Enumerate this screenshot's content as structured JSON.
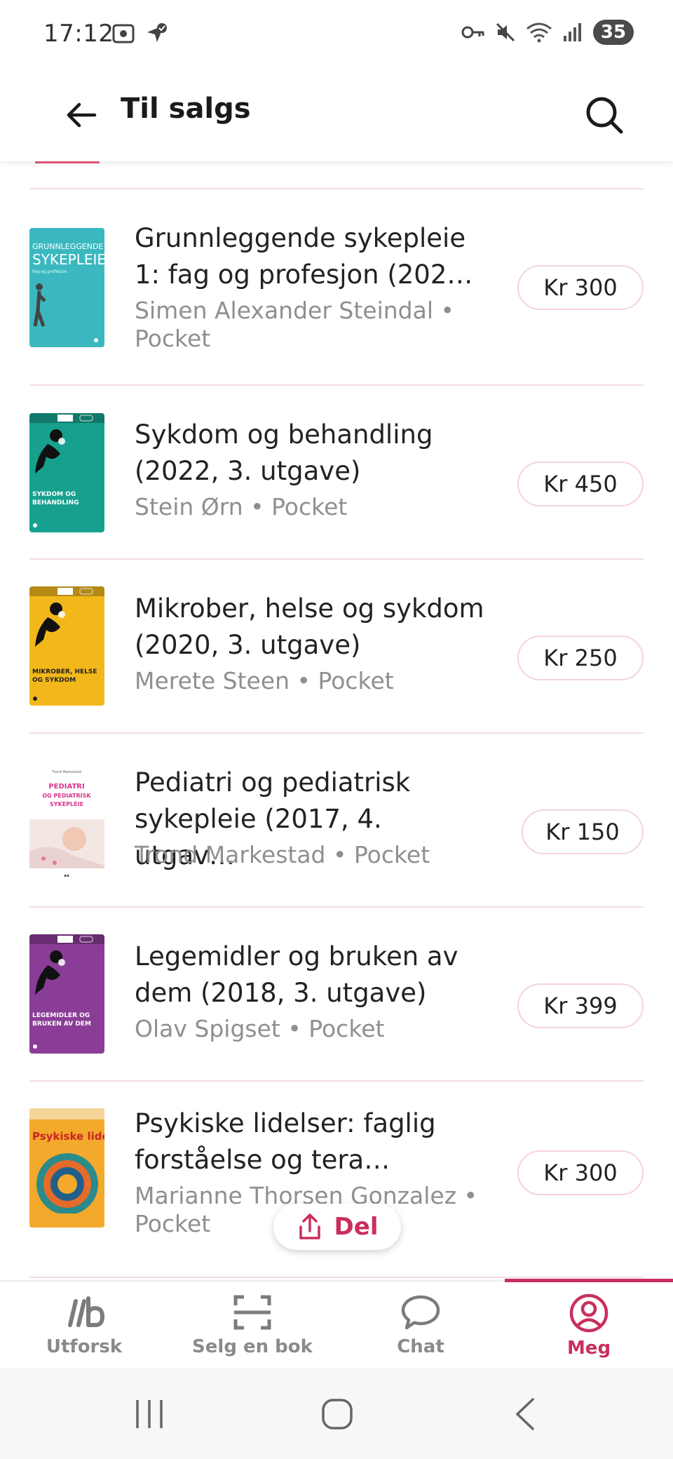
{
  "status_bar": {
    "time": "17:12",
    "battery": "35"
  },
  "app_bar": {
    "title": "Til salgs"
  },
  "books": [
    {
      "title": "Grunnleggende sykepleie 1: fag og profesjon (202…",
      "meta": "Simen Alexander Steindal • Pocket",
      "price": "Kr 300",
      "cover_color": "#3bb8bf",
      "cover_text": "GRUNNLEGGENDE SYKEPLEIE",
      "cover_sub": "Fag og profesjon"
    },
    {
      "title": "Sykdom og behandling (2022, 3. utgave)",
      "meta": "Stein Ørn • Pocket",
      "price": "Kr 450",
      "cover_color": "#17a08e",
      "cover_text": "SYKDOM OG BEHANDLING"
    },
    {
      "title": "Mikrober, helse og sykdom (2020, 3. utgave)",
      "meta": "Merete Steen • Pocket",
      "price": "Kr 250",
      "cover_color": "#f2b81b",
      "cover_text": "MIKROBER, HELSE OG SYKDOM"
    },
    {
      "title": "Pediatri og pediatrisk sykepleie (2017, 4. utgav…",
      "meta": "Trond Markestad • Pocket",
      "price": "Kr 150",
      "cover_color": "#ffffff",
      "cover_text": "PEDIATRI OG PEDIATRISK SYKEPLEIE"
    },
    {
      "title": "Legemidler og bruken av dem (2018, 3. utgave)",
      "meta": "Olav Spigset • Pocket",
      "price": "Kr 399",
      "cover_color": "#8a3d96",
      "cover_text": "LEGEMIDLER OG BRUKEN AV DEM"
    },
    {
      "title": "Psykiske lidelser: faglig forståelse og tera…",
      "meta": "Marianne Thorsen Gonzalez • Pocket",
      "price": "Kr 300",
      "cover_color": "#f3a92b",
      "cover_text": "Psykiske lidelse"
    }
  ],
  "share": {
    "label": "Del"
  },
  "bottom_nav": [
    {
      "label": "Utforsk",
      "icon": "explore-icon",
      "active": false
    },
    {
      "label": "Selg en bok",
      "icon": "scan-icon",
      "active": false
    },
    {
      "label": "Chat",
      "icon": "chat-icon",
      "active": false
    },
    {
      "label": "Meg",
      "icon": "profile-icon",
      "active": true
    }
  ],
  "colors": {
    "accent": "#c92f5c",
    "divider": "#f3dce2",
    "meta_text": "#8f8f8f"
  }
}
